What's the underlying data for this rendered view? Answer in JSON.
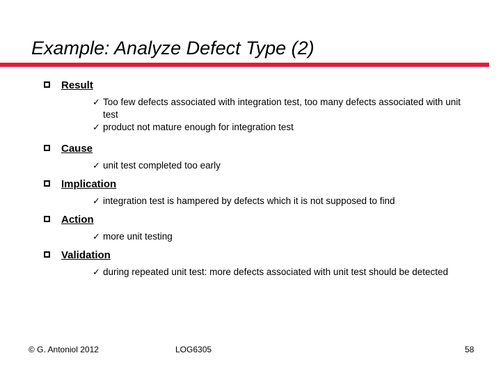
{
  "slide": {
    "title": "Example: Analyze Defect Type (2)",
    "accent_color": "#e31b3d",
    "background_color": "#ffffff",
    "text_color": "#000000",
    "bullet_icon": "hollow-square-bullet",
    "sub_bullet_icon": "check-mark-bullet",
    "sub_bullet_glyph": "✓"
  },
  "sections": [
    {
      "heading": "Result",
      "items": [
        "Too few defects associated with integration test, too many defects associated with unit test",
        "product not mature enough for integration test"
      ]
    },
    {
      "heading": "Cause",
      "items": [
        "unit test completed too early"
      ]
    },
    {
      "heading": "Implication",
      "items": [
        "integration test is hampered by defects which it is not supposed to find"
      ]
    },
    {
      "heading": "Action",
      "items": [
        "more unit testing"
      ]
    },
    {
      "heading": "Validation",
      "items": [
        "during repeated unit test: more defects associated with unit test should be detected"
      ]
    }
  ],
  "footer": {
    "copyright": "© G. Antoniol 2012",
    "course": "LOG6305",
    "page_number": "58"
  }
}
